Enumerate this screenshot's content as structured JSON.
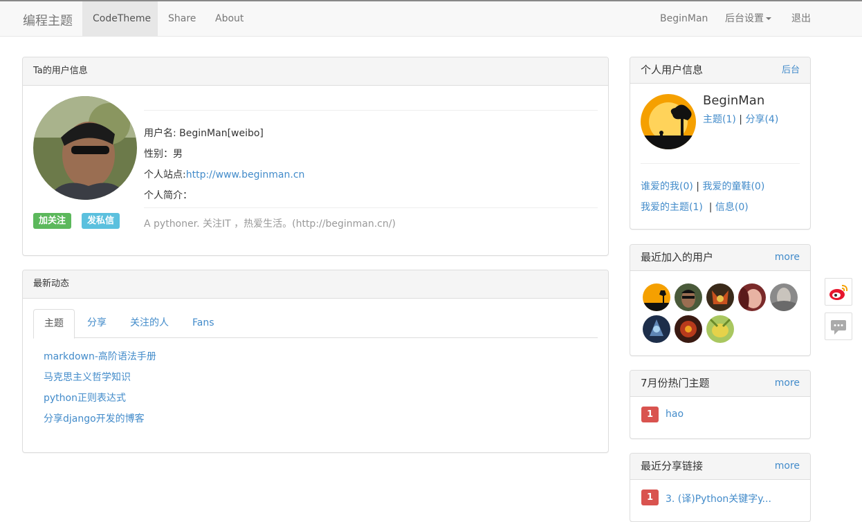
{
  "navbar": {
    "brand": "编程主题",
    "items": [
      {
        "label": "CodeTheme",
        "active": true
      },
      {
        "label": "Share"
      },
      {
        "label": "About"
      }
    ],
    "right": {
      "user": "BeginMan",
      "settings": "后台设置",
      "logout": "退出"
    }
  },
  "profile_panel": {
    "heading": "Ta的用户信息",
    "username_line": "用户名: BeginMan[weibo]",
    "gender_line": "性别：男",
    "site_label": "个人站点:",
    "site_url": "http://www.beginman.cn",
    "bio_label": "个人简介：",
    "bio": "A pythoner. 关注IT ，热爱生活。(http://beginman.cn/)",
    "follow_btn": "加关注",
    "message_btn": "发私信"
  },
  "activity_panel": {
    "heading": "最新动态",
    "tabs": [
      "主题",
      "分享",
      "关注的人",
      "Fans"
    ],
    "posts": [
      "markdown-高阶语法手册",
      "马克思主义哲学知识",
      "python正则表达式",
      "分享django开发的博客"
    ]
  },
  "user_info_panel": {
    "heading": "个人用户信息",
    "admin_link": "后台",
    "name": "BeginMan",
    "topics": "主题(1)",
    "sep": "|",
    "shares": "分享(4)",
    "loved_me": "谁爱的我(0)",
    "my_loves": "我爱的童鞋(0)",
    "my_fav_topics": "我爱的主题(1)",
    "messages": "信息(0)"
  },
  "recent_users_panel": {
    "heading": "最近加入的用户",
    "more": "more",
    "avatars": [
      "avatar-1",
      "avatar-2",
      "avatar-3",
      "avatar-4",
      "avatar-5",
      "avatar-6",
      "avatar-7",
      "avatar-8"
    ]
  },
  "hot_topics_panel": {
    "heading": "7月份热门主题",
    "more": "more",
    "items": [
      {
        "rank": "1",
        "title": "hao"
      }
    ]
  },
  "recent_shares_panel": {
    "heading": "最近分享链接",
    "more": "more",
    "items": [
      {
        "rank": "1",
        "title": "3. (译)Python关键字y..."
      }
    ]
  },
  "colors": {
    "link": "#428bca",
    "success": "#5cb85c",
    "info": "#5bc0de",
    "danger": "#d9534f"
  }
}
